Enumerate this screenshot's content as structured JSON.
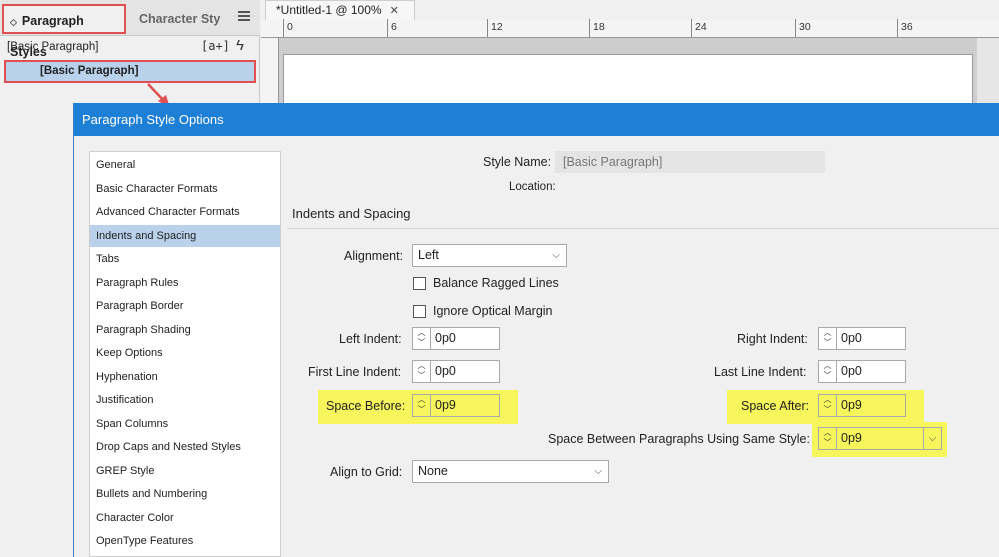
{
  "styles_panel": {
    "tabs": [
      "Paragraph Styles",
      "Character Sty"
    ],
    "current_style": "[Basic Paragraph]",
    "new_style_icon_text": "[a+]",
    "items": [
      "[Basic Paragraph]"
    ]
  },
  "document": {
    "tab_title": "*Untitled-1 @ 100%",
    "ruler_labels": [
      "0",
      "6",
      "12",
      "18",
      "24",
      "30",
      "36"
    ]
  },
  "dialog": {
    "title": "Paragraph Style Options",
    "sidebar": [
      "General",
      "Basic Character Formats",
      "Advanced Character Formats",
      "Indents and Spacing",
      "Tabs",
      "Paragraph Rules",
      "Paragraph Border",
      "Paragraph Shading",
      "Keep Options",
      "Hyphenation",
      "Justification",
      "Span Columns",
      "Drop Caps and Nested Styles",
      "GREP Style",
      "Bullets and Numbering",
      "Character Color",
      "OpenType Features"
    ],
    "selected_index": 3,
    "style_name_label": "Style Name:",
    "style_name_value": "[Basic Paragraph]",
    "location_label": "Location:",
    "section_title": "Indents and Spacing",
    "alignment_label": "Alignment:",
    "alignment_value": "Left",
    "balance_ragged_label": "Balance Ragged Lines",
    "ignore_optical_label": "Ignore Optical Margin",
    "left_indent_label": "Left Indent:",
    "left_indent_value": "0p0",
    "right_indent_label": "Right Indent:",
    "right_indent_value": "0p0",
    "first_line_label": "First Line Indent:",
    "first_line_value": "0p0",
    "last_line_label": "Last Line Indent:",
    "last_line_value": "0p0",
    "space_before_label": "Space Before:",
    "space_before_value": "0p9",
    "space_after_label": "Space After:",
    "space_after_value": "0p9",
    "space_between_label": "Space Between Paragraphs Using Same Style:",
    "space_between_value": "0p9",
    "align_grid_label": "Align to Grid:",
    "align_grid_value": "None"
  },
  "colors": {
    "titlebar": "#1e7fd6",
    "highlight": "#f7f55c",
    "annotation": "#e05050",
    "selection": "#b9d1ea"
  }
}
